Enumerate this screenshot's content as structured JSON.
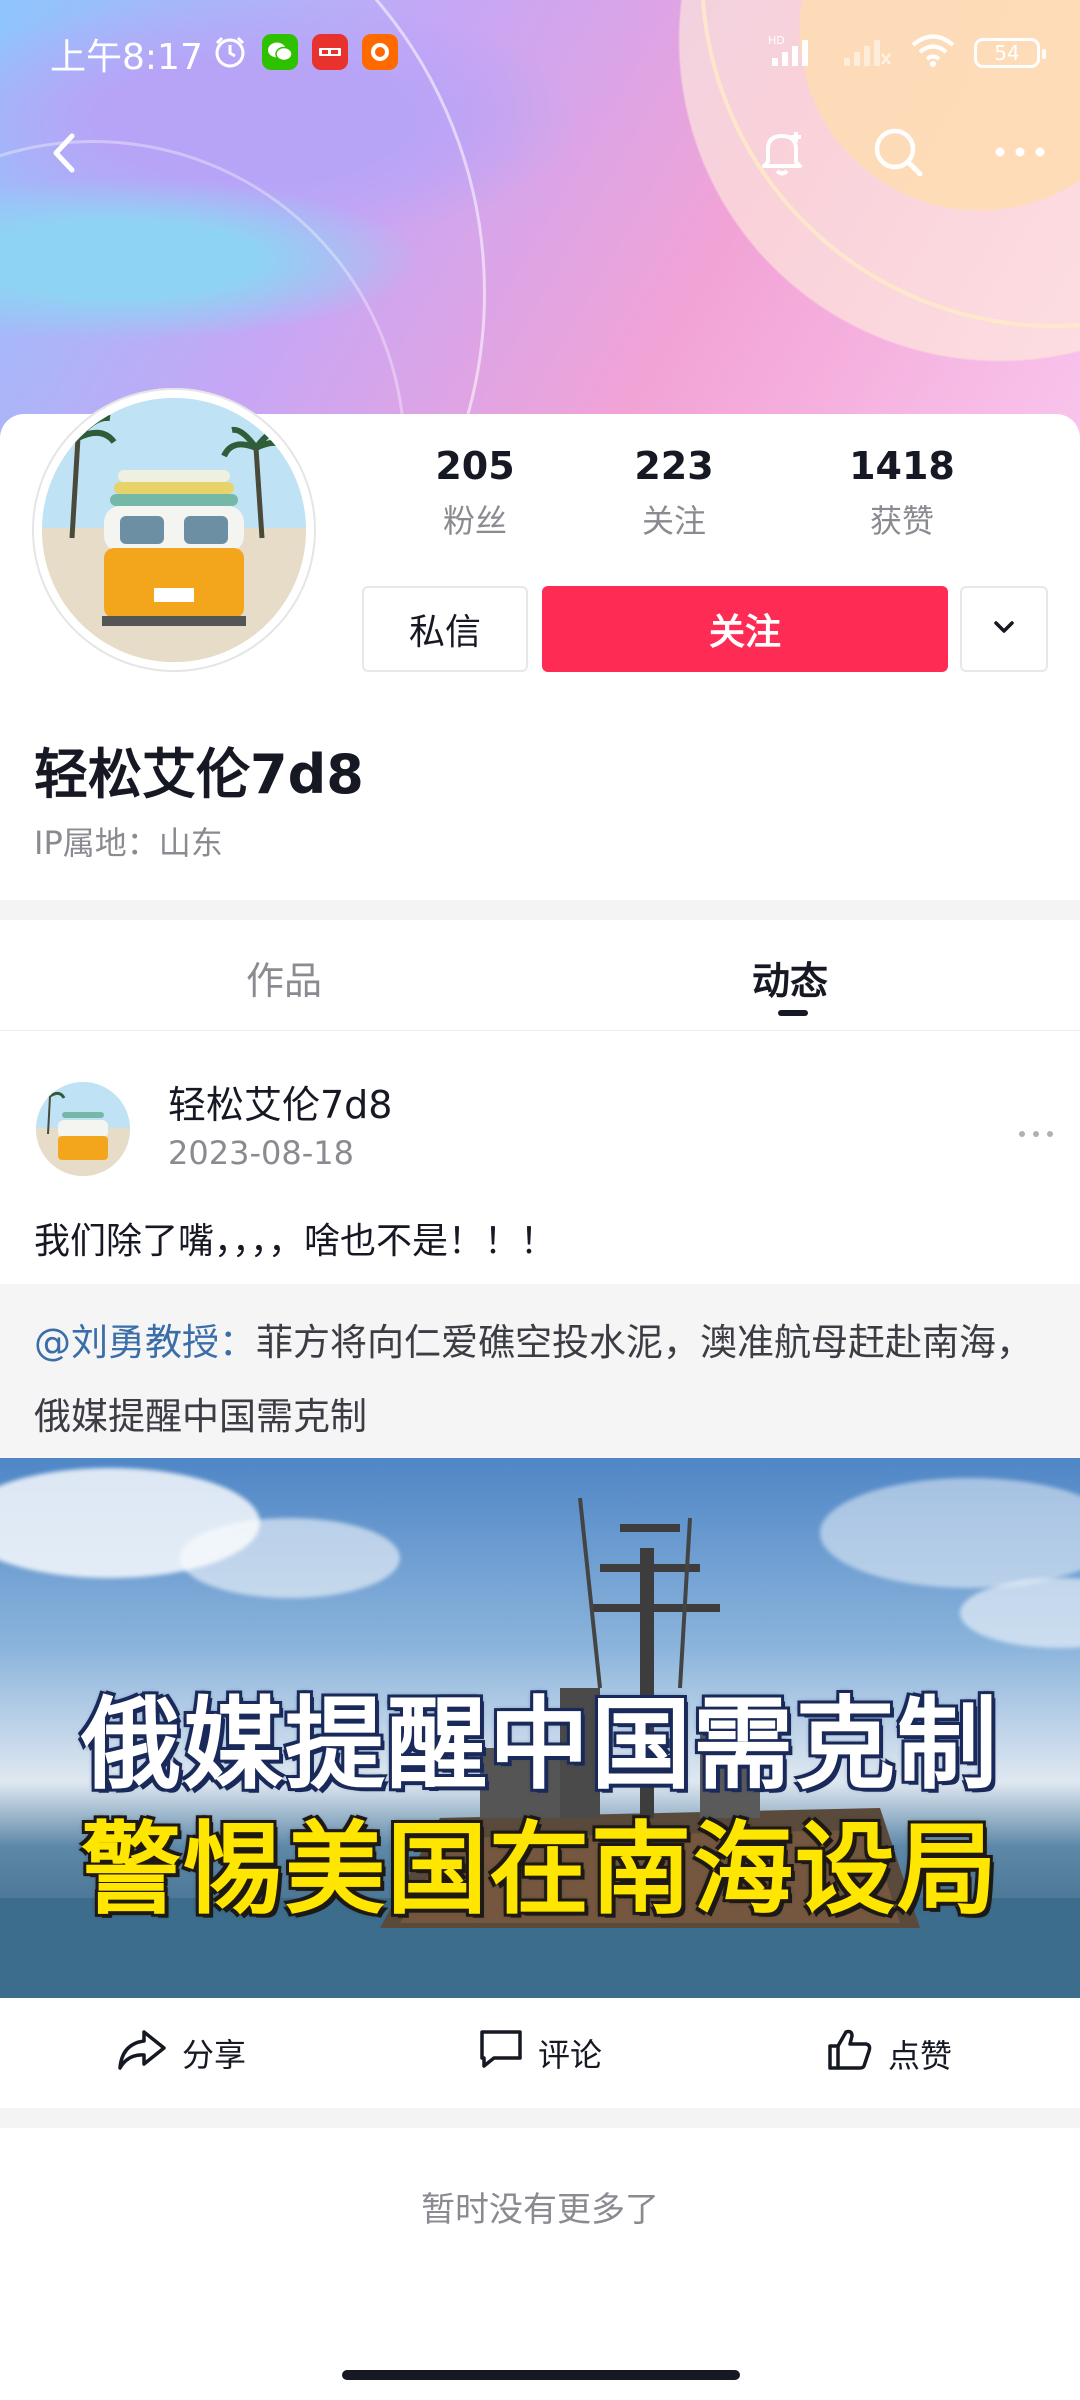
{
  "status_bar": {
    "time": "上午8:17",
    "app_icons": [
      "alarm-icon",
      "wechat-icon",
      "toutiao-icon",
      "taobao-icon"
    ],
    "network_label": "HD",
    "battery": "54"
  },
  "nav": {
    "icons": [
      "back-icon",
      "notification-bell-icon",
      "search-icon",
      "more-icon"
    ]
  },
  "profile": {
    "name": "轻松艾伦7d8",
    "ip_location": "IP属地：山东",
    "stats": [
      {
        "value": "205",
        "label": "粉丝"
      },
      {
        "value": "223",
        "label": "关注"
      },
      {
        "value": "1418",
        "label": "获赞"
      }
    ],
    "message_button": "私信",
    "follow_button": "关注"
  },
  "tabs": [
    {
      "label": "作品",
      "active": false
    },
    {
      "label": "动态",
      "active": true
    }
  ],
  "post": {
    "author": "轻松艾伦7d8",
    "date": "2023-08-18",
    "text": "我们除了嘴，，，，啥也不是！！！",
    "quote_mention": "@刘勇教授：",
    "quote_text": "菲方将向仁爱礁空投水泥，澳准航母赶赴南海，俄媒提醒中国需克制",
    "image_headline_1": "俄媒提醒中国需克制",
    "image_headline_2": "警惕美国在南海设局",
    "actions": {
      "share": "分享",
      "comment": "评论",
      "like": "点赞"
    }
  },
  "footer": {
    "no_more": "暂时没有更多了"
  },
  "colors": {
    "accent": "#fe2c55",
    "mention": "#3b6ea8",
    "headline_yellow": "#ffe600"
  }
}
